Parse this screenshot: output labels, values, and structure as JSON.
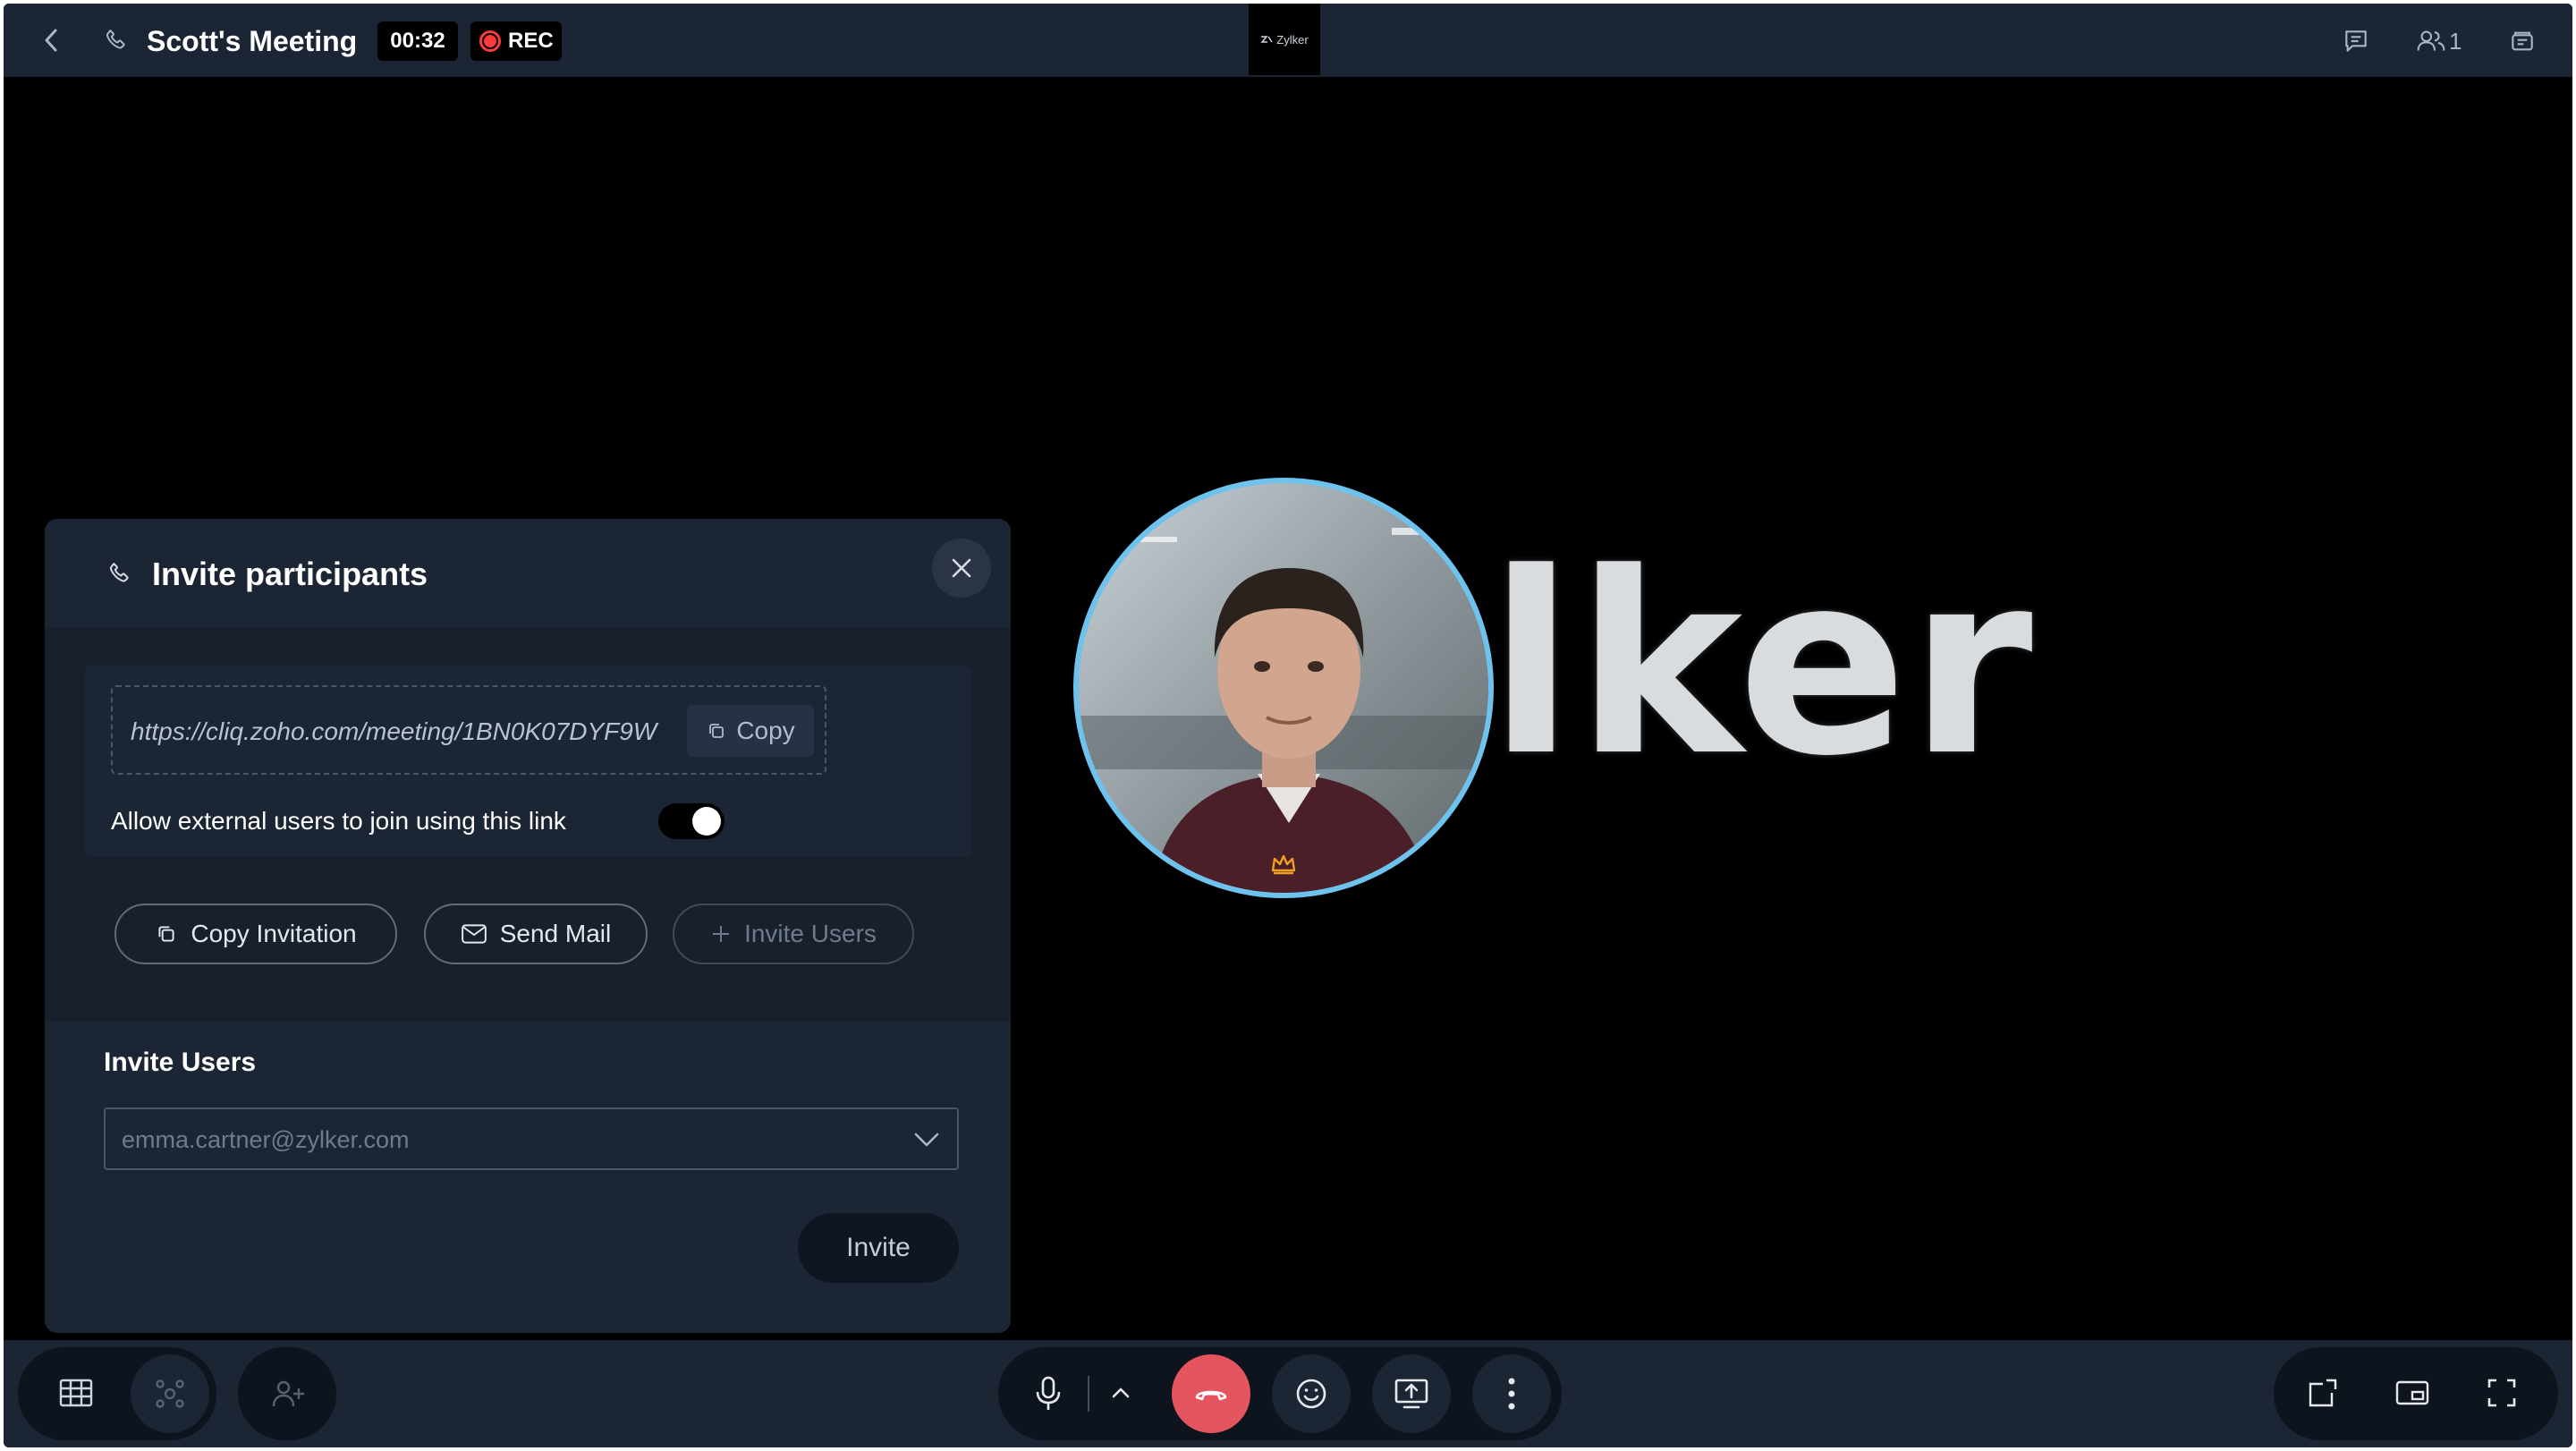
{
  "meeting": {
    "title": "Scott's Meeting",
    "timer": "00:32",
    "rec_label": "REC",
    "brand": "Zylker",
    "participant_count": "1"
  },
  "stage": {
    "background_word": "lker",
    "speaker_ring_color": "#6ec3ee"
  },
  "dialog": {
    "title": "Invite participants",
    "meeting_link": "https://cliq.zoho.com/meeting/1BN0K07DYF9W",
    "copy_label": "Copy",
    "allow_external_label": "Allow external users to join using this link",
    "allow_external_enabled": true,
    "actions": {
      "copy_invitation": "Copy Invitation",
      "send_mail": "Send Mail",
      "invite_users": "Invite Users"
    },
    "invite_section_label": "Invite Users",
    "invite_placeholder": "emma.cartner@zylker.com",
    "invite_button": "Invite"
  },
  "colors": {
    "end_call": "#e5555f",
    "crown": "#f0a020",
    "rec": "#ff3b3b"
  }
}
